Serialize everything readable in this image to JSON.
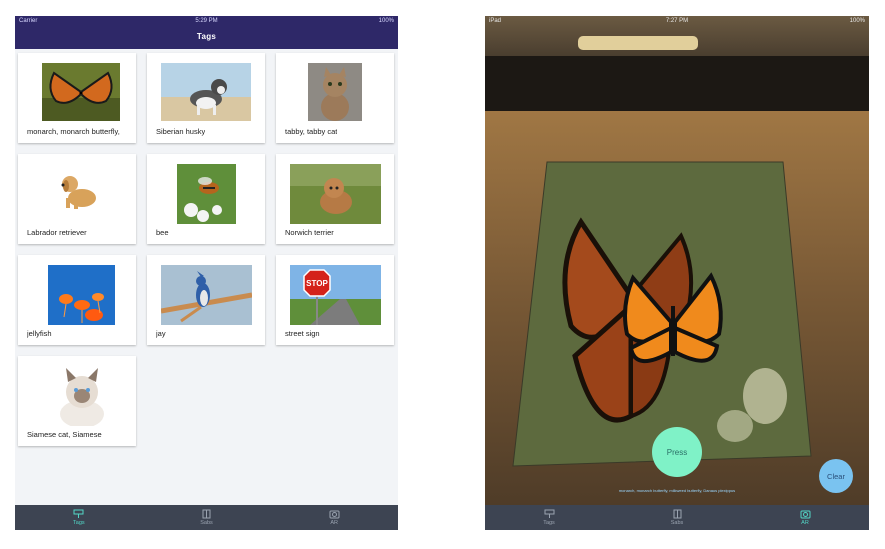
{
  "left": {
    "status": {
      "carrier": "Carrier",
      "time": "5:29 PM",
      "battery": "100%"
    },
    "nav_title": "Tags",
    "cards": [
      {
        "label": "monarch, monarch butterfly,"
      },
      {
        "label": "Siberian husky"
      },
      {
        "label": "tabby, tabby cat"
      },
      {
        "label": "Labrador retriever"
      },
      {
        "label": "bee"
      },
      {
        "label": "Norwich terrier"
      },
      {
        "label": "jellyfish"
      },
      {
        "label": "jay"
      },
      {
        "label": "street sign"
      },
      {
        "label": "Siamese cat, Siamese"
      }
    ],
    "tabs": [
      {
        "label": "Tags",
        "icon": "tag-icon",
        "active": true
      },
      {
        "label": "Sabs",
        "icon": "book-icon",
        "active": false
      },
      {
        "label": "AR",
        "icon": "camera-icon",
        "active": false
      }
    ]
  },
  "right": {
    "status": {
      "device": "iPad",
      "time": "7:27 PM",
      "battery": "100%"
    },
    "press_label": "Press",
    "clear_label": "Clear",
    "caption": "monarch, monarch butterfly, milkweed butterfly, Danaus plexippus",
    "tabs": [
      {
        "label": "Tags",
        "icon": "tag-icon",
        "active": false
      },
      {
        "label": "Sabs",
        "icon": "book-icon",
        "active": false
      },
      {
        "label": "AR",
        "icon": "camera-icon",
        "active": true
      }
    ]
  },
  "colors": {
    "nav": "#2e2868",
    "tabbar": "#3d4452",
    "accent": "#52d6c6",
    "press": "#7ff2c7",
    "clear": "#7ac3f0"
  }
}
